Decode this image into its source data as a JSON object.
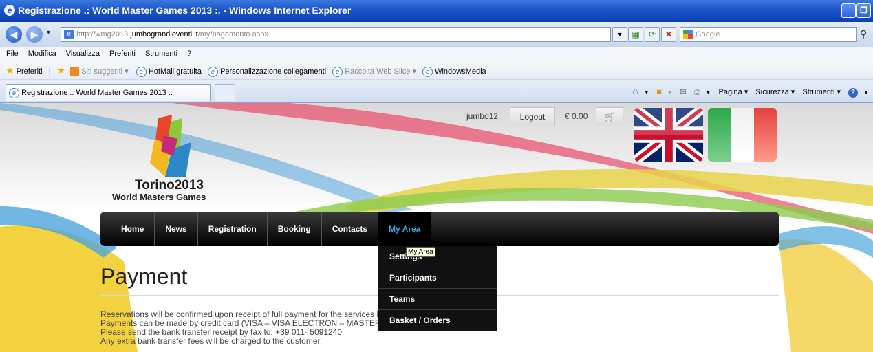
{
  "window": {
    "title": "Registrazione .: World Master Games 2013 :. - Windows Internet Explorer",
    "minimize": "_",
    "restore": "❐"
  },
  "address": {
    "url_prefix": "http://wmg2013.",
    "url_domain": "jumbograndieventi.it",
    "url_path": "/my/pagamento.aspx",
    "search_placeholder": "Google"
  },
  "menu": [
    "File",
    "Modifica",
    "Visualizza",
    "Preferiti",
    "Strumenti",
    "?"
  ],
  "favorites": {
    "label": "Preferiti",
    "items": [
      "Siti suggeriti ▾",
      "HotMail gratuita",
      "Personalizzazione collegamenti",
      "Raccolta Web Slice ▾",
      "WindowsMedia"
    ]
  },
  "tabs": {
    "active_label": "Registrazione .: World Master Games 2013 :."
  },
  "commandbar": {
    "items": [
      "Pagina ▾",
      "Sicurezza ▾",
      "Strumenti ▾"
    ]
  },
  "site": {
    "user": "jumbo12",
    "logout": "Logout",
    "total": "€ 0.00",
    "logo_line1": "Torino2013",
    "logo_line2": "World Masters Games",
    "nav": [
      "Home",
      "News",
      "Registration",
      "Booking",
      "Contacts",
      "My Area"
    ],
    "tooltip": "My Area",
    "dropdown": [
      "Settings",
      "Participants",
      "Teams",
      "Basket / Orders"
    ],
    "page_title": "Payment",
    "body_lines": [
      "Reservations will be confirmed upon receipt of full payment for the services booked at Jumbo Grandi Eventi.",
      "Payments can be made by credit card (VISA – VISA ELECTRON – MASTERCARD) or by bank transfer.",
      "Please send the bank transfer receipt by fax to: +39 011- 5091240",
      "Any extra bank transfer fees will be charged to the customer."
    ]
  }
}
